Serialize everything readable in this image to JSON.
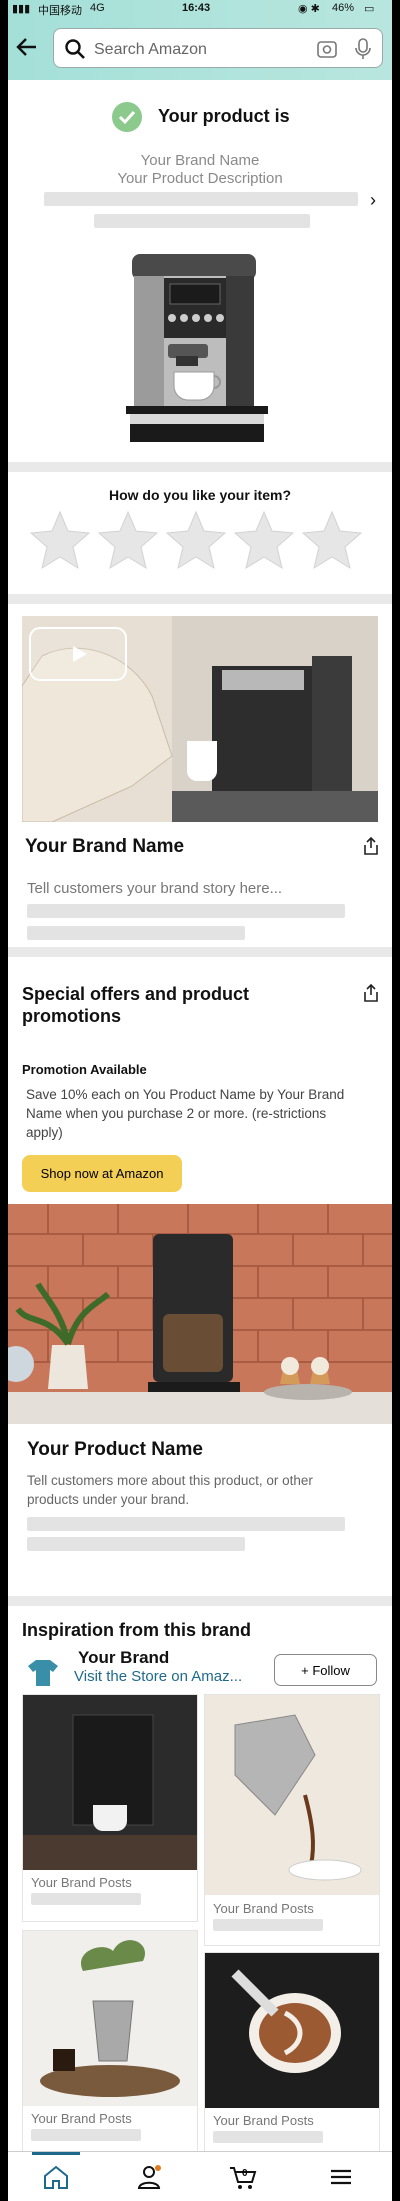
{
  "status": {
    "carrier": "中国移动",
    "network": "4G",
    "time": "16:43",
    "battery": "46%"
  },
  "search": {
    "placeholder": "Search Amazon"
  },
  "product": {
    "title": "Your product is",
    "brand": "Your Brand Name",
    "description": "Your Product Description"
  },
  "rating": {
    "question": "How do you like your item?",
    "stars_total": 5
  },
  "brand_story": {
    "name": "Your Brand Name",
    "story_placeholder": "Tell customers your brand story here..."
  },
  "offers": {
    "title": "Special offers and product promotions",
    "promo_heading": "Promotion Available",
    "promo_text": "Save 10% each on You Product Name by Your Brand Name when you purchase 2 or more. (re-strictions apply)",
    "shop_button": "Shop now at Amazon",
    "product_name": "Your Product Name",
    "product_desc": "Tell customers more about this product, or other products under your brand."
  },
  "inspiration": {
    "title": "Inspiration from this brand",
    "brand": "Your Brand",
    "visit": "Visit the Store on Amaz...",
    "follow": "+ Follow",
    "posts": [
      "Your Brand Posts",
      "Your Brand Posts",
      "Your Brand Posts",
      "Your Brand Posts"
    ]
  },
  "colors": {
    "accent": "#f4cf55",
    "header": "#a4e0d8",
    "link": "#1f6a8c"
  },
  "icons": {
    "home": "home-icon",
    "account": "account-icon",
    "cart": "cart-icon",
    "menu": "menu-icon"
  },
  "cart": {
    "count": "0"
  }
}
